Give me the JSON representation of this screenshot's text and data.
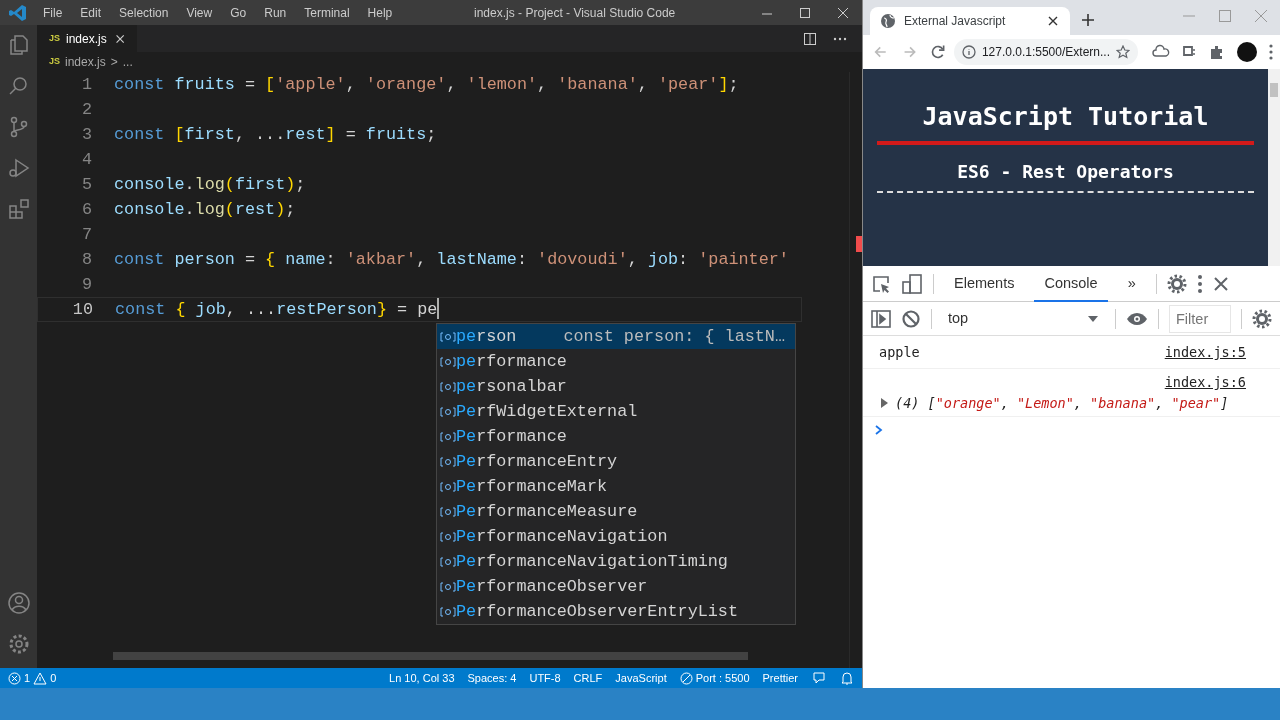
{
  "vscode": {
    "menu": [
      "File",
      "Edit",
      "Selection",
      "View",
      "Go",
      "Run",
      "Terminal",
      "Help"
    ],
    "title": "index.js - Project - Visual Studio Code",
    "tabs": [
      {
        "badge": "JS",
        "label": "index.js",
        "selected": true
      }
    ],
    "breadcrumb": {
      "badge": "JS",
      "file": "index.js",
      "separator": ">",
      "rest": "..."
    },
    "code_lines": [
      {
        "number": "1",
        "current": false,
        "tokens": [
          {
            "text": "const ",
            "kind": "kw"
          },
          {
            "text": "fruits",
            "kind": "var"
          },
          {
            "text": " = ",
            "kind": "plain"
          },
          {
            "text": "[",
            "kind": "bracket"
          },
          {
            "text": "'apple'",
            "kind": "str"
          },
          {
            "text": ", ",
            "kind": "plain"
          },
          {
            "text": "'orange'",
            "kind": "str"
          },
          {
            "text": ", ",
            "kind": "plain"
          },
          {
            "text": "'lemon'",
            "kind": "str"
          },
          {
            "text": ", ",
            "kind": "plain"
          },
          {
            "text": "'banana'",
            "kind": "str"
          },
          {
            "text": ", ",
            "kind": "plain"
          },
          {
            "text": "'pear'",
            "kind": "str"
          },
          {
            "text": "]",
            "kind": "bracket"
          },
          {
            "text": ";",
            "kind": "plain"
          }
        ]
      },
      {
        "number": "2",
        "current": false
      },
      {
        "number": "3",
        "current": false,
        "tokens": [
          {
            "text": "const ",
            "kind": "kw"
          },
          {
            "text": "[",
            "kind": "bracket"
          },
          {
            "text": "first",
            "kind": "var"
          },
          {
            "text": ", ...",
            "kind": "plain"
          },
          {
            "text": "rest",
            "kind": "var"
          },
          {
            "text": "]",
            "kind": "bracket"
          },
          {
            "text": " = ",
            "kind": "plain"
          },
          {
            "text": "fruits",
            "kind": "var"
          },
          {
            "text": ";",
            "kind": "plain"
          }
        ]
      },
      {
        "number": "4",
        "current": false
      },
      {
        "number": "5",
        "current": false,
        "tokens": [
          {
            "text": "console",
            "kind": "var"
          },
          {
            "text": ".",
            "kind": "plain"
          },
          {
            "text": "log",
            "kind": "func"
          },
          {
            "text": "(",
            "kind": "bracket"
          },
          {
            "text": "first",
            "kind": "var"
          },
          {
            "text": ")",
            "kind": "bracket"
          },
          {
            "text": ";",
            "kind": "plain"
          }
        ]
      },
      {
        "number": "6",
        "current": false,
        "tokens": [
          {
            "text": "console",
            "kind": "var"
          },
          {
            "text": ".",
            "kind": "plain"
          },
          {
            "text": "log",
            "kind": "func"
          },
          {
            "text": "(",
            "kind": "bracket"
          },
          {
            "text": "rest",
            "kind": "var"
          },
          {
            "text": ")",
            "kind": "bracket"
          },
          {
            "text": ";",
            "kind": "plain"
          }
        ]
      },
      {
        "number": "7",
        "current": false
      },
      {
        "number": "8",
        "current": false,
        "tokens": [
          {
            "text": "const ",
            "kind": "kw"
          },
          {
            "text": "person",
            "kind": "var"
          },
          {
            "text": " = ",
            "kind": "plain"
          },
          {
            "text": "{",
            "kind": "bracket"
          },
          {
            "text": " name",
            "kind": "var"
          },
          {
            "text": ": ",
            "kind": "plain"
          },
          {
            "text": "'akbar'",
            "kind": "str"
          },
          {
            "text": ", ",
            "kind": "plain"
          },
          {
            "text": "lastName",
            "kind": "var"
          },
          {
            "text": ": ",
            "kind": "plain"
          },
          {
            "text": "'dovoudi'",
            "kind": "str"
          },
          {
            "text": ", ",
            "kind": "plain"
          },
          {
            "text": "job",
            "kind": "var"
          },
          {
            "text": ": ",
            "kind": "plain"
          },
          {
            "text": "'painter'",
            "kind": "str"
          }
        ]
      },
      {
        "number": "9",
        "current": false
      },
      {
        "number": "10",
        "current": true,
        "tokens": [
          {
            "text": "const ",
            "kind": "kw"
          },
          {
            "text": "{",
            "kind": "bracket"
          },
          {
            "text": " job",
            "kind": "var"
          },
          {
            "text": ", ...",
            "kind": "plain"
          },
          {
            "text": "restPerson",
            "kind": "var"
          },
          {
            "text": "}",
            "kind": "bracket"
          },
          {
            "text": " = ",
            "kind": "plain"
          },
          {
            "text": "pe",
            "kind": "plain"
          }
        ]
      }
    ],
    "suggestions": [
      {
        "match": "pe",
        "rest": "rson",
        "detail": "const person: { lastN…",
        "selected": true
      },
      {
        "match": "pe",
        "rest": "rformance",
        "selected": false
      },
      {
        "match": "pe",
        "rest": "rsonalbar",
        "selected": false
      },
      {
        "match": "Pe",
        "rest": "rfWidgetExternal",
        "selected": false
      },
      {
        "match": "Pe",
        "rest": "rformance",
        "selected": false
      },
      {
        "match": "Pe",
        "rest": "rformanceEntry",
        "selected": false
      },
      {
        "match": "Pe",
        "rest": "rformanceMark",
        "selected": false
      },
      {
        "match": "Pe",
        "rest": "rformanceMeasure",
        "selected": false
      },
      {
        "match": "Pe",
        "rest": "rformanceNavigation",
        "selected": false
      },
      {
        "match": "Pe",
        "rest": "rformanceNavigationTiming",
        "selected": false
      },
      {
        "match": "Pe",
        "rest": "rformanceObserver",
        "selected": false
      },
      {
        "match": "Pe",
        "rest": "rformanceObserverEntryList",
        "selected": false
      }
    ],
    "status_bar": {
      "errors": "1",
      "warnings": "0",
      "items": [
        {
          "kind": "text",
          "text": "Ln 10, Col 33"
        },
        {
          "kind": "text",
          "text": "Spaces: 4"
        },
        {
          "kind": "text",
          "text": "UTF-8"
        },
        {
          "kind": "text",
          "text": "CRLF"
        },
        {
          "kind": "text",
          "text": "JavaScript"
        },
        {
          "kind": "port",
          "text": "Port : 5500"
        },
        {
          "kind": "text",
          "text": "Prettier"
        }
      ]
    }
  },
  "browser": {
    "tab_title": "External Javascript",
    "url": "127.0.0.1:5500/Extern...",
    "page": {
      "heading": "JavaScript Tutorial",
      "subheading": "ES6 - Rest Operators"
    },
    "devtools": {
      "tabs": [
        {
          "label": "Elements",
          "selected": false
        },
        {
          "label": "Console",
          "selected": true
        }
      ],
      "more": "»",
      "context": "top",
      "filter_placeholder": "Filter",
      "messages": [
        {
          "kind": "text",
          "source": "index.js:5",
          "tokens": [
            {
              "text": "apple",
              "kind": "plain"
            }
          ]
        },
        {
          "kind": "array",
          "expanded": false,
          "source": "index.js:6",
          "tokens": [
            {
              "text": "(4) [",
              "kind": "plain"
            },
            {
              "text": "\"orange\"",
              "kind": "str"
            },
            {
              "text": ", ",
              "kind": "plain"
            },
            {
              "text": "\"Lemon\"",
              "kind": "str"
            },
            {
              "text": ", ",
              "kind": "plain"
            },
            {
              "text": "\"banana\"",
              "kind": "str"
            },
            {
              "text": ", ",
              "kind": "plain"
            },
            {
              "text": "\"pear\"",
              "kind": "str"
            },
            {
              "text": "]",
              "kind": "plain"
            }
          ]
        }
      ]
    }
  }
}
